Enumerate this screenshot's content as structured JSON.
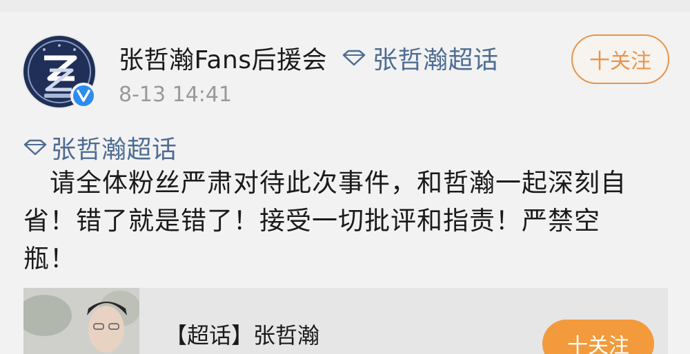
{
  "post": {
    "username": "张哲瀚Fans后援会",
    "header_topic": "张哲瀚超话",
    "timestamp": "8-13 14:41",
    "follow_label": "十关注",
    "topic_link": "张哲瀚超话",
    "body_lines": [
      "　请全体粉丝严肃对待此次事件，和哲瀚一起深刻自",
      "省！错了就是错了！接受一切批评和指责！严禁空",
      "瓶！"
    ]
  },
  "card": {
    "title": "【超话】张哲瀚",
    "follow_label": "十关注"
  },
  "colors": {
    "topic_blue": "#4d6c93",
    "follow_orange": "#e8944a",
    "card_button_orange": "#f39a3c",
    "verified_blue": "#2d8cf0"
  },
  "icons": {
    "avatar": "fan-club-logo",
    "verified": "verified-v-icon",
    "topic": "diamond-icon"
  }
}
